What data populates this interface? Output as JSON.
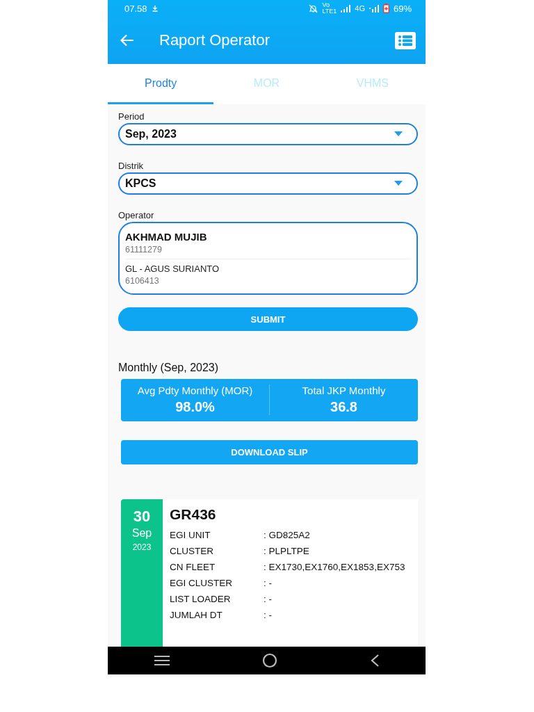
{
  "status_bar": {
    "time": "07.58",
    "volte": [
      "Vo",
      "LTE1"
    ],
    "network": "4G",
    "battery": "69%"
  },
  "app_bar": {
    "title": "Raport Operator"
  },
  "tabs": [
    {
      "label": "Prodty",
      "selected": true
    },
    {
      "label": "MOR",
      "selected": false
    },
    {
      "label": "VHMS",
      "selected": false
    }
  ],
  "form": {
    "period": {
      "label": "Period",
      "value": "Sep, 2023"
    },
    "distrik": {
      "label": "Distrik",
      "value": "KPCS"
    },
    "operator": {
      "label": "Operator",
      "entries": [
        {
          "kind": "operator",
          "name": "AKHMAD MUJIB",
          "id": "61111279"
        },
        {
          "kind": "leader",
          "name": "GL - AGUS SURIANTO",
          "id": "6106413"
        }
      ]
    },
    "submit": "SUBMIT"
  },
  "monthly": {
    "title": "Monthly (Sep, 2023)",
    "stats": [
      {
        "label": "Avg Pdty Monthly (MOR)",
        "value": "98.0%"
      },
      {
        "label": "Total JKP Monthly",
        "value": "36.8"
      }
    ]
  },
  "download": "DOWNLOAD SLIP",
  "records": [
    {
      "day": "30",
      "month": "Sep",
      "year": "2023",
      "title": "GR436",
      "fields": [
        {
          "label": "EGI UNIT",
          "value": ": GD825A2"
        },
        {
          "label": "CLUSTER",
          "value": ": PLPLTPE"
        },
        {
          "label": "CN FLEET",
          "value": ": EX1730,EX1760,EX1853,EX753"
        },
        {
          "label": "EGI CLUSTER",
          "value": ": -"
        },
        {
          "label": "LIST LOADER",
          "value": ": -"
        },
        {
          "label": "JUMLAH DT",
          "value": ": -"
        }
      ]
    }
  ]
}
